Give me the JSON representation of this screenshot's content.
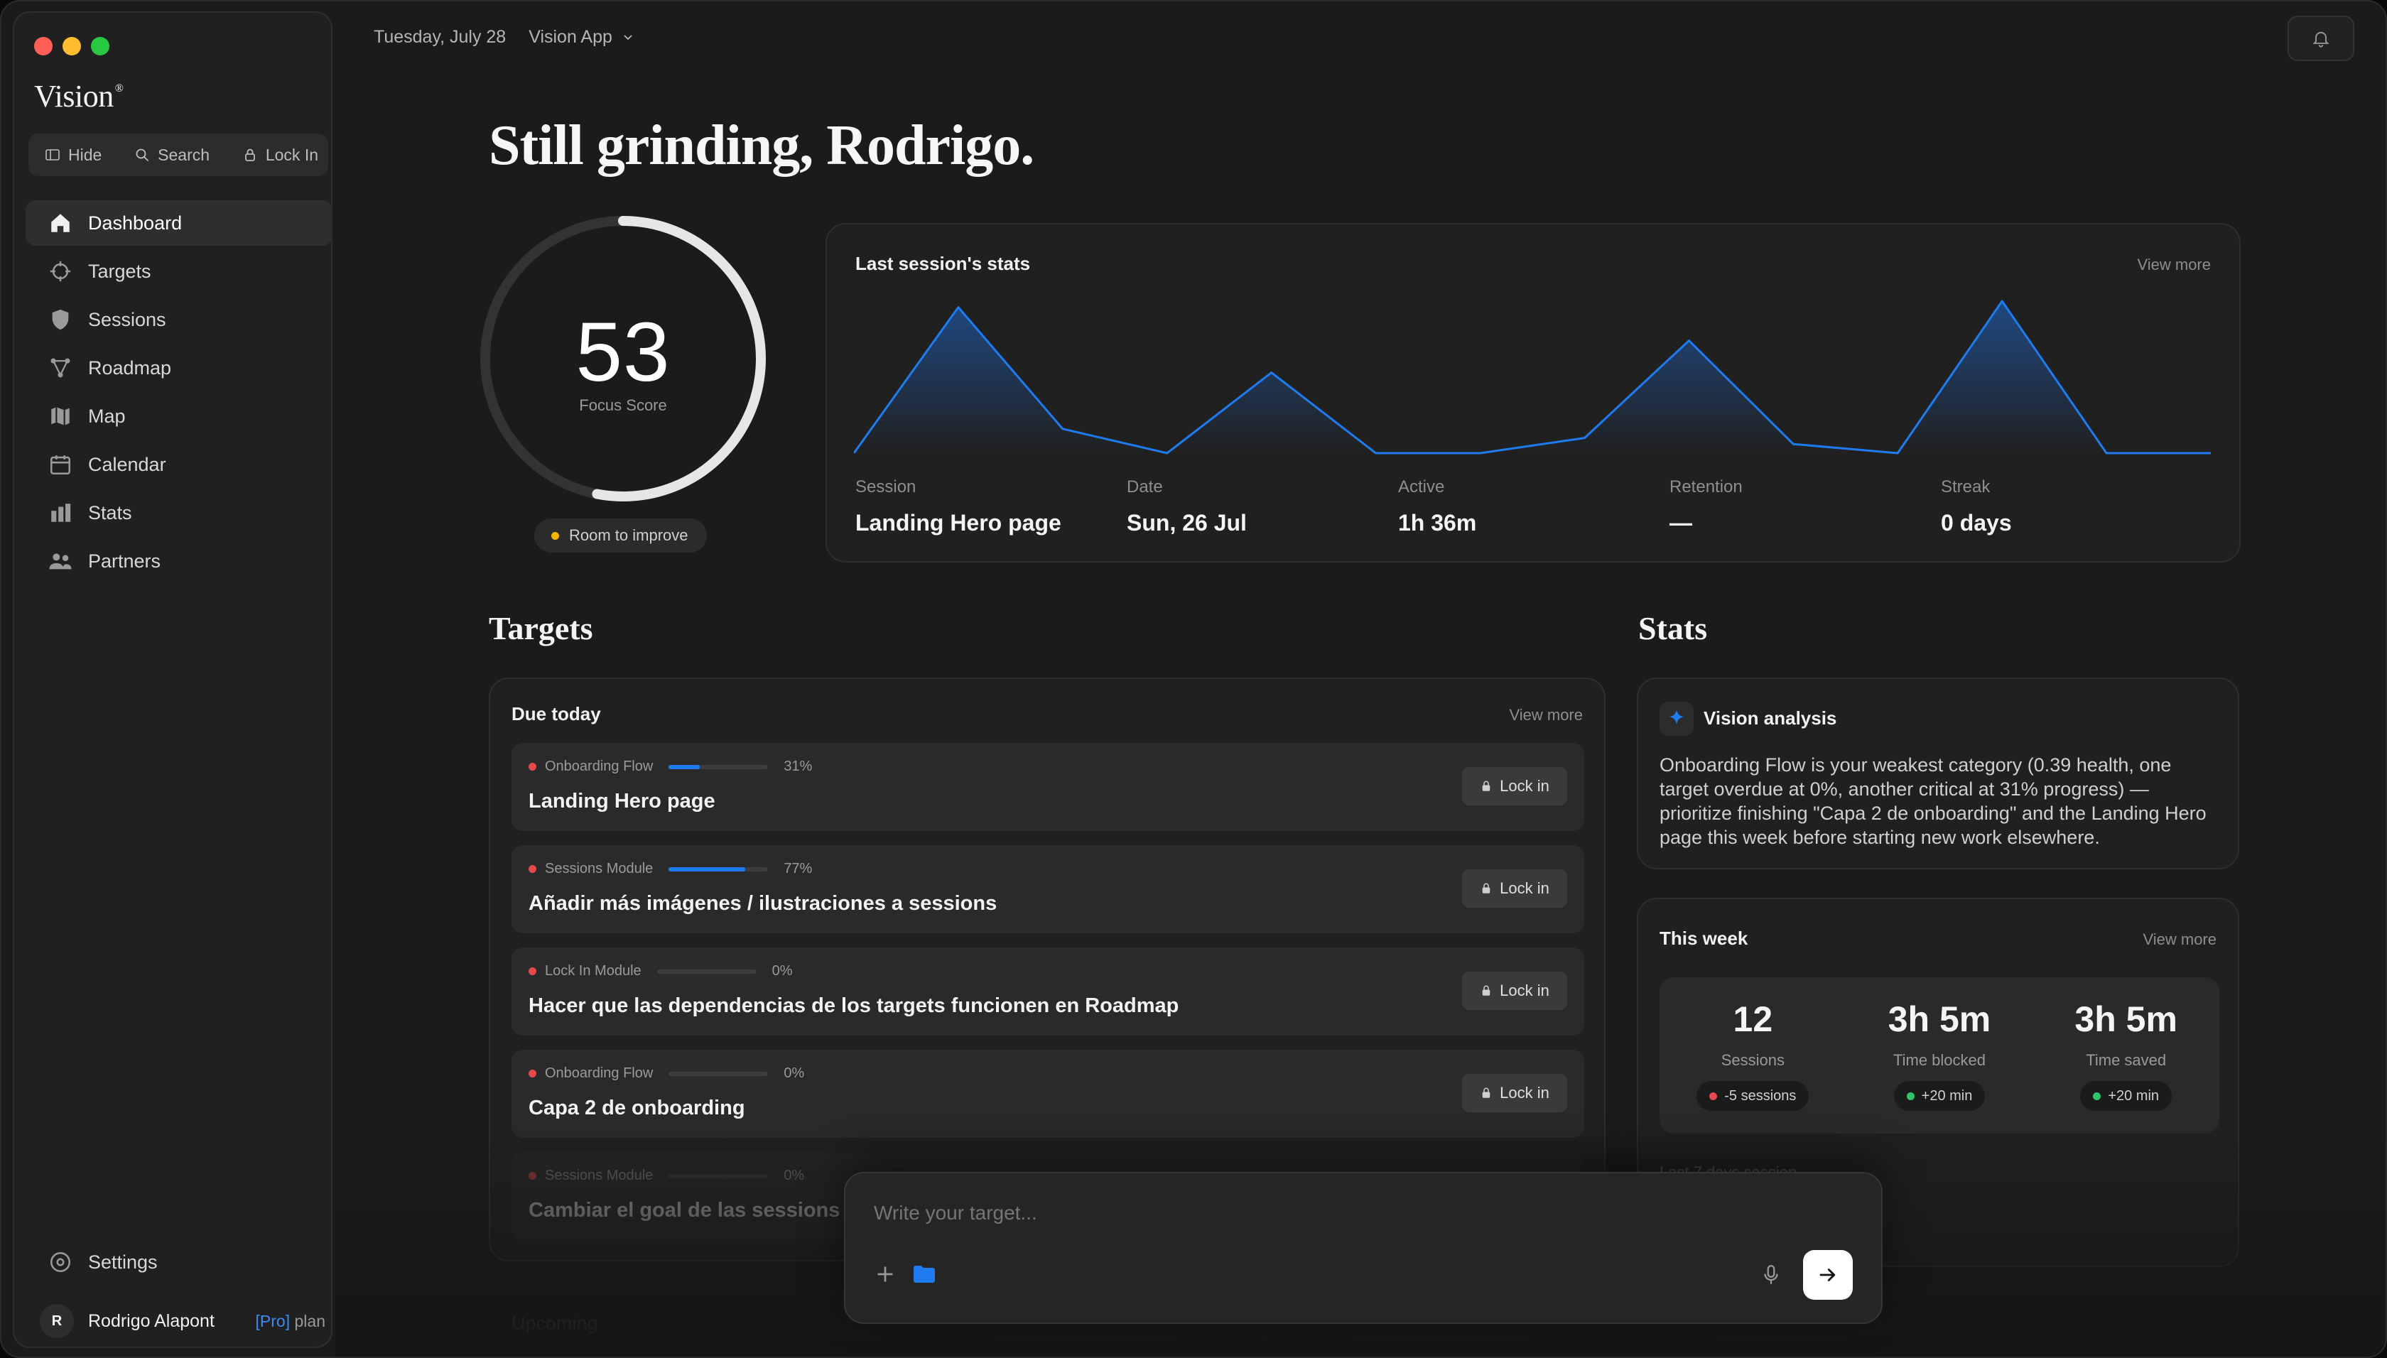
{
  "sidebar": {
    "logo": "Vision",
    "logo_mark": "®",
    "quick": {
      "hide": "Hide",
      "search": "Search",
      "lock_in": "Lock In"
    },
    "items": [
      {
        "label": "Dashboard",
        "icon": "home-icon",
        "active": true
      },
      {
        "label": "Targets",
        "icon": "crosshair-icon"
      },
      {
        "label": "Sessions",
        "icon": "shield-icon"
      },
      {
        "label": "Roadmap",
        "icon": "nodes-icon"
      },
      {
        "label": "Map",
        "icon": "map-icon"
      },
      {
        "label": "Calendar",
        "icon": "calendar-icon"
      },
      {
        "label": "Stats",
        "icon": "bar-chart-icon"
      },
      {
        "label": "Partners",
        "icon": "people-icon"
      }
    ],
    "settings": "Settings",
    "user": {
      "initial": "R",
      "name": "Rodrigo Alapont",
      "plan_tag": "[Pro]",
      "plan_word": "plan"
    }
  },
  "topbar": {
    "date": "Tuesday, July 28",
    "app": "Vision App"
  },
  "greeting": "Still grinding, Rodrigo.",
  "focus": {
    "score": "53",
    "label": "Focus Score",
    "progress": 0.53,
    "status": "Room to improve",
    "status_color": "#f5b400"
  },
  "last_session": {
    "title": "Last session's stats",
    "view_more": "View more",
    "chart_data": {
      "type": "area",
      "values": [
        0,
        96,
        16,
        0,
        53,
        0,
        0,
        10,
        74,
        6,
        0,
        100,
        0,
        0
      ],
      "ylim": [
        0,
        100
      ]
    },
    "stats": [
      {
        "label": "Session",
        "value": "Landing Hero page"
      },
      {
        "label": "Date",
        "value": "Sun, 26 Jul"
      },
      {
        "label": "Active",
        "value": "1h 36m"
      },
      {
        "label": "Retention",
        "value": "—"
      },
      {
        "label": "Streak",
        "value": "0 days"
      }
    ]
  },
  "targets": {
    "section_title": "Targets",
    "card_title": "Due today",
    "view_more": "View more",
    "lock_label": "Lock in",
    "items": [
      {
        "category": "Onboarding Flow",
        "progress": 0.31,
        "pct": "31%",
        "name": "Landing Hero page"
      },
      {
        "category": "Sessions Module",
        "progress": 0.77,
        "pct": "77%",
        "name": "Añadir más imágenes / ilustraciones a sessions"
      },
      {
        "category": "Lock In Module",
        "progress": 0,
        "pct": "0%",
        "name": "Hacer que las dependencias de los targets funcionen en Roadmap"
      },
      {
        "category": "Onboarding Flow",
        "progress": 0,
        "pct": "0%",
        "name": "Capa 2 de onboarding"
      },
      {
        "category": "Sessions Module",
        "progress": 0,
        "pct": "0%",
        "name": "Cambiar el goal de las sessions"
      }
    ],
    "upcoming": "Upcoming"
  },
  "stats": {
    "section_title": "Stats",
    "analysis": {
      "title": "Vision analysis",
      "text": "Onboarding Flow is your weakest category (0.39 health, one target overdue at 0%, another critical at 31% progress) — prioritize finishing \"Capa 2 de onboarding\" and the Landing Hero page this week before starting new work elsewhere."
    },
    "week": {
      "title": "This week",
      "view_more": "View more",
      "items": [
        {
          "value": "12",
          "label": "Sessions",
          "delta": "-5 sessions",
          "delta_color": "#e5484d"
        },
        {
          "value": "3h 5m",
          "label": "Time blocked",
          "delta": "+20 min",
          "delta_color": "#30c46b"
        },
        {
          "value": "3h 5m",
          "label": "Time saved",
          "delta": "+20 min",
          "delta_color": "#30c46b"
        }
      ],
      "faded_label": "Last 7 days session"
    }
  },
  "composer": {
    "placeholder": "Write your target..."
  },
  "colors": {
    "accent": "#1f7bf0",
    "red_dot": "#e5484d",
    "traffic_red": "#ff5f57",
    "traffic_yellow": "#febc2e",
    "traffic_green": "#28c840"
  }
}
